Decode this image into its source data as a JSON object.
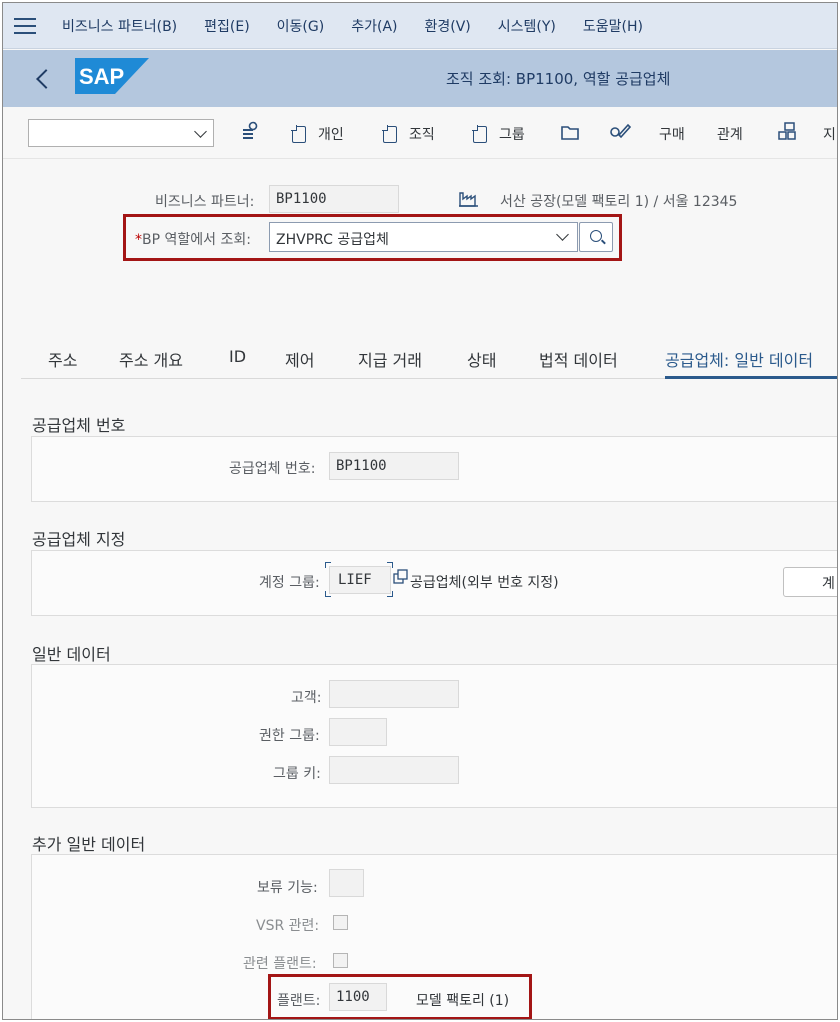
{
  "menubar": {
    "items": [
      "비즈니스 파트너(B)",
      "편집(E)",
      "이동(G)",
      "추가(A)",
      "환경(V)",
      "시스템(Y)",
      "도움말(H)"
    ]
  },
  "titlebar": {
    "logo_text": "SAP",
    "title": "조직 조회: BP1100, 역할 공급업체"
  },
  "toolbar": {
    "select_value": "",
    "buttons": [
      "개인",
      "조직",
      "그룹",
      "구매",
      "관계",
      "지"
    ]
  },
  "header": {
    "bp_label": "비즈니스 파트너:",
    "bp_value": "BP1100",
    "bp_description": "서산 공장(모델 팩토리 1) / 서울 12345",
    "role_required_mark": "*",
    "role_label": "BP 역할에서 조회:",
    "role_value": "ZHVPRC 공급업체"
  },
  "tabs": [
    "주소",
    "주소 개요",
    "ID",
    "제어",
    "지급 거래",
    "상태",
    "법적 데이터",
    "공급업체: 일반 데이터"
  ],
  "sections": {
    "vendor_number": {
      "title": "공급업체 번호",
      "label": "공급업체 번호:",
      "value": "BP1100"
    },
    "vendor_assignment": {
      "title": "공급업체 지정",
      "account_group_label": "계정 그룹:",
      "account_group_value": "LIEF",
      "account_group_text": "공급업체(외부 번호 지정)",
      "side_button": "계"
    },
    "general_data": {
      "title": "일반 데이터",
      "customer_label": "고객:",
      "auth_group_label": "권한 그룹:",
      "group_key_label": "그룹 키:"
    },
    "additional_data": {
      "title": "추가 일반 데이터",
      "hold_label": "보류 기능:",
      "vsr_label": "VSR 관련:",
      "plant_rel_label": "관련 플랜트:",
      "plant_label": "플랜트:",
      "plant_value": "1100",
      "plant_text": "모델 팩토리 (1)"
    }
  },
  "colors": {
    "menubar_bg": "#dfe7f2",
    "titlebar_bg": "#b4c7de",
    "highlight_box": "#a31515",
    "sap_blue": "#1f8ad6",
    "active_tab": "#2b5a8c"
  }
}
